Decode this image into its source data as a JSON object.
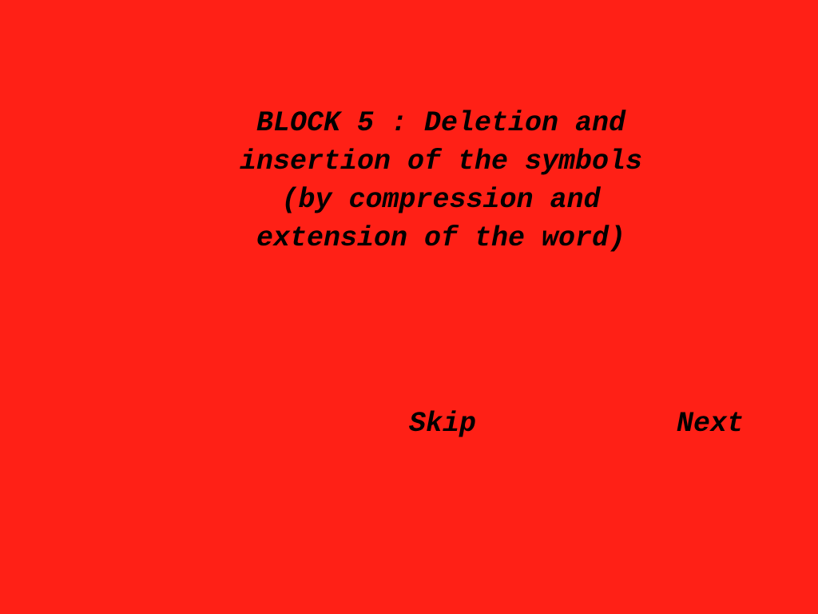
{
  "screen": {
    "background_color": "#ff2016",
    "text_color": "#000000"
  },
  "title": {
    "lines": [
      "BLOCK 5 : Deletion and",
      "insertion of the symbols",
      "(by compression and",
      "extension of the word)"
    ]
  },
  "navigation": {
    "skip_label": "Skip",
    "next_label": "Next"
  }
}
